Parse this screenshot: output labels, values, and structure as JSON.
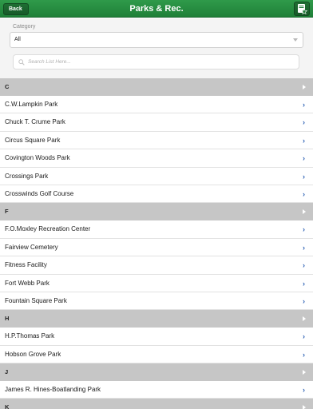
{
  "header": {
    "back_label": "Back",
    "title": "Parks & Rec."
  },
  "filter": {
    "category_label": "Category",
    "category_value": "All",
    "search_placeholder": "Search List Here..."
  },
  "sections": [
    {
      "letter": "C",
      "items": [
        "C.W.Lampkin Park",
        "Chuck T. Crume Park",
        "Circus Square Park",
        "Covington Woods Park",
        "Crossings Park",
        "Crosswinds Golf Course"
      ]
    },
    {
      "letter": "F",
      "items": [
        "F.O.Moxley Recreation Center",
        "Fairview Cemetery",
        "Fitness Facility",
        "Fort Webb Park",
        "Fountain Square Park"
      ]
    },
    {
      "letter": "H",
      "items": [
        "H.P.Thomas Park",
        "Hobson Grove Park"
      ]
    },
    {
      "letter": "J",
      "items": [
        "James R. Hines-Boatlanding Park"
      ]
    },
    {
      "letter": "K",
      "items": []
    }
  ],
  "colors": {
    "header_green": "#2f9a4a",
    "section_gray": "#c6c6c6",
    "chevron_blue": "#2b5fb4"
  },
  "icons": {
    "favorites": "bookmark-star-icon",
    "search": "magnifier-icon",
    "row_chevron": "chevron-right-icon",
    "section_arrow": "triangle-right-icon"
  }
}
